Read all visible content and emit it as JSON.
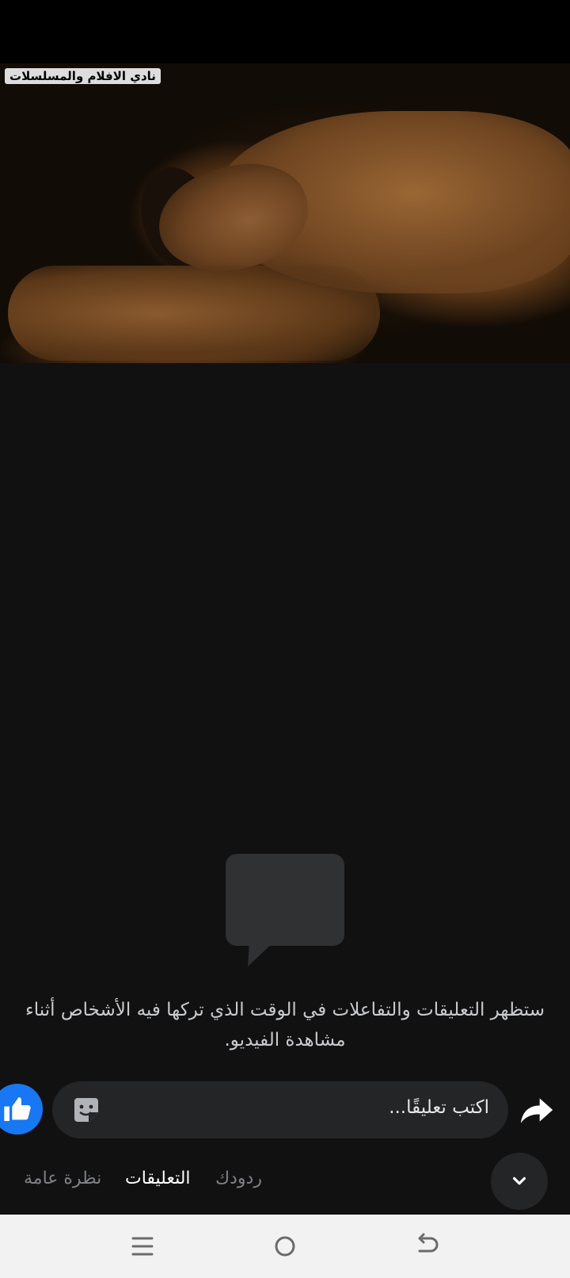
{
  "video": {
    "watermark": "نادي الافلام والمسلسلات"
  },
  "comments": {
    "empty_message": "ستظهر التعليقات والتفاعلات في الوقت الذي تركها فيه الأشخاص أثناء مشاهدة الفيديو."
  },
  "composer": {
    "placeholder": "اكتب تعليقًا..."
  },
  "tabs": [
    {
      "label": "نظرة عامة"
    },
    {
      "label": "التعليقات"
    },
    {
      "label": "ردودك"
    }
  ],
  "colors": {
    "background": "#111112",
    "like_blue": "#1877f2",
    "input_bg": "#242526",
    "active_tab": "#ffffff",
    "inactive_tab": "#7f8185",
    "nav_bar": "#f2f2f2"
  },
  "icons": {
    "like": "thumbs-up-icon",
    "sticker": "sticker-icon",
    "share": "share-arrow-icon",
    "collapse": "chevron-down-icon",
    "empty_state": "speech-bubble-icon"
  }
}
